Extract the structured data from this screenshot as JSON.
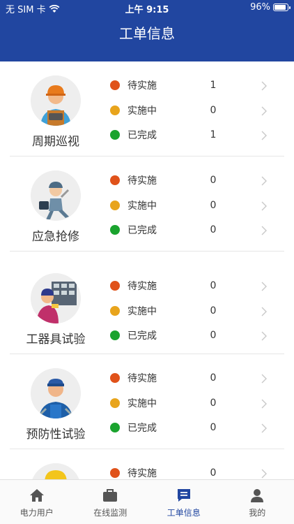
{
  "status_bar": {
    "carrier": "无 SIM 卡",
    "time": "上午 9:15",
    "battery": "96%",
    "battery_level": 0.96
  },
  "header": {
    "title": "工单信息"
  },
  "colors": {
    "primary": "#2146a0",
    "pending": "#e0521a",
    "in_progress": "#e8a41c",
    "done": "#1aa32e"
  },
  "categories": [
    {
      "name": "周期巡视",
      "icon": "inspector-avatar-icon",
      "rows": [
        {
          "label": "待实施",
          "count": "1"
        },
        {
          "label": "实施中",
          "count": "0"
        },
        {
          "label": "已完成",
          "count": "1"
        }
      ]
    },
    {
      "name": "应急抢修",
      "icon": "repairman-avatar-icon",
      "rows": [
        {
          "label": "待实施",
          "count": "0"
        },
        {
          "label": "实施中",
          "count": "0"
        },
        {
          "label": "已完成",
          "count": "0"
        }
      ]
    },
    {
      "name": "工器具试验",
      "icon": "tool-test-avatar-icon",
      "rows": [
        {
          "label": "待实施",
          "count": "0"
        },
        {
          "label": "实施中",
          "count": "0"
        },
        {
          "label": "已完成",
          "count": "0"
        }
      ]
    },
    {
      "name": "预防性试验",
      "icon": "worker-avatar-icon",
      "rows": [
        {
          "label": "待实施",
          "count": "0"
        },
        {
          "label": "实施中",
          "count": "0"
        },
        {
          "label": "已完成",
          "count": "0"
        }
      ]
    },
    {
      "name": "",
      "icon": "hardhat-avatar-icon",
      "rows": [
        {
          "label": "待实施",
          "count": "0"
        }
      ]
    }
  ],
  "tabs": [
    {
      "label": "电力用户",
      "icon": "home-icon"
    },
    {
      "label": "在线监测",
      "icon": "briefcase-icon"
    },
    {
      "label": "工单信息",
      "icon": "message-icon",
      "active": true
    },
    {
      "label": "我的",
      "icon": "person-icon"
    }
  ]
}
